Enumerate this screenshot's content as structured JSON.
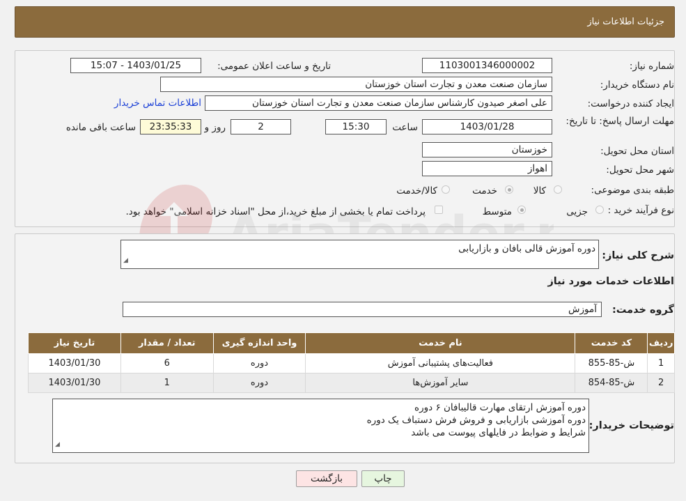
{
  "header": {
    "title": "جزئیات اطلاعات نیاز"
  },
  "form": {
    "need_number_label": "شماره نیاز:",
    "need_number": "1103001346000002",
    "announce_label": "تاریخ و ساعت اعلان عمومی:",
    "announce_value": "1403/01/25 - 15:07",
    "buyer_org_label": "نام دستگاه خریدار:",
    "buyer_org": "سازمان صنعت معدن و تجارت استان خوزستان",
    "creator_label": "ایجاد کننده درخواست:",
    "creator": "علی اصغر صیدون کارشناس سازمان صنعت معدن و تجارت استان خوزستان",
    "contact_link": "اطلاعات تماس خریدار",
    "deadline_label": "مهلت ارسال پاسخ: تا تاریخ:",
    "deadline_date": "1403/01/28",
    "time_label": "ساعت",
    "deadline_time": "15:30",
    "days_value": "2",
    "days_label": "روز و",
    "remaining_time": "23:35:33",
    "remaining_label": "ساعت باقی مانده",
    "province_label": "استان محل تحویل:",
    "province": "خوزستان",
    "city_label": "شهر محل تحویل:",
    "city": "اهواز",
    "category_label": "طبقه بندی موضوعی:",
    "category_options": [
      "کالا",
      "خدمت",
      "کالا/خدمت"
    ],
    "process_label": "نوع فرآیند خرید :",
    "process_options": [
      "جزیی",
      "متوسط"
    ],
    "payment_note": "پرداخت تمام یا بخشی از مبلغ خرید،از محل \"اسناد خزانه اسلامی\" خواهد بود."
  },
  "details": {
    "summary_label": "شرح کلی نیاز:",
    "summary": "دوره آموزش قالی بافان و بازاریابی",
    "services_title": "اطلاعات خدمات مورد نیاز",
    "group_label": "گروه خدمت:",
    "group_value": "آموزش",
    "table": {
      "headers": [
        "ردیف",
        "کد خدمت",
        "نام خدمت",
        "واحد اندازه گیری",
        "تعداد / مقدار",
        "تاریخ نیاز"
      ],
      "rows": [
        [
          "1",
          "ش-85-855",
          "فعالیت‌های پشتیبانی آموزش",
          "دوره",
          "6",
          "1403/01/30"
        ],
        [
          "2",
          "ش-85-854",
          "سایر آموزش‌ها",
          "دوره",
          "1",
          "1403/01/30"
        ]
      ]
    },
    "buyer_notes_label": "توضیحات خریدار:",
    "buyer_notes": [
      "دوره آموزش ارتقای مهارت قالیبافان ۶ دوره",
      "دوره آموزشی بازاریابی و فروش فرش دستباف یک دوره",
      "شرایط و ضوابط در فایلهای پیوست می باشد"
    ]
  },
  "buttons": {
    "print": "چاپ",
    "back": "بازگشت"
  },
  "watermark": "AriaTender.net",
  "colors": {
    "header_bg": "#8b6b3d",
    "back_button_bg": "#fde4e4",
    "print_button_bg": "#e6f6df"
  }
}
